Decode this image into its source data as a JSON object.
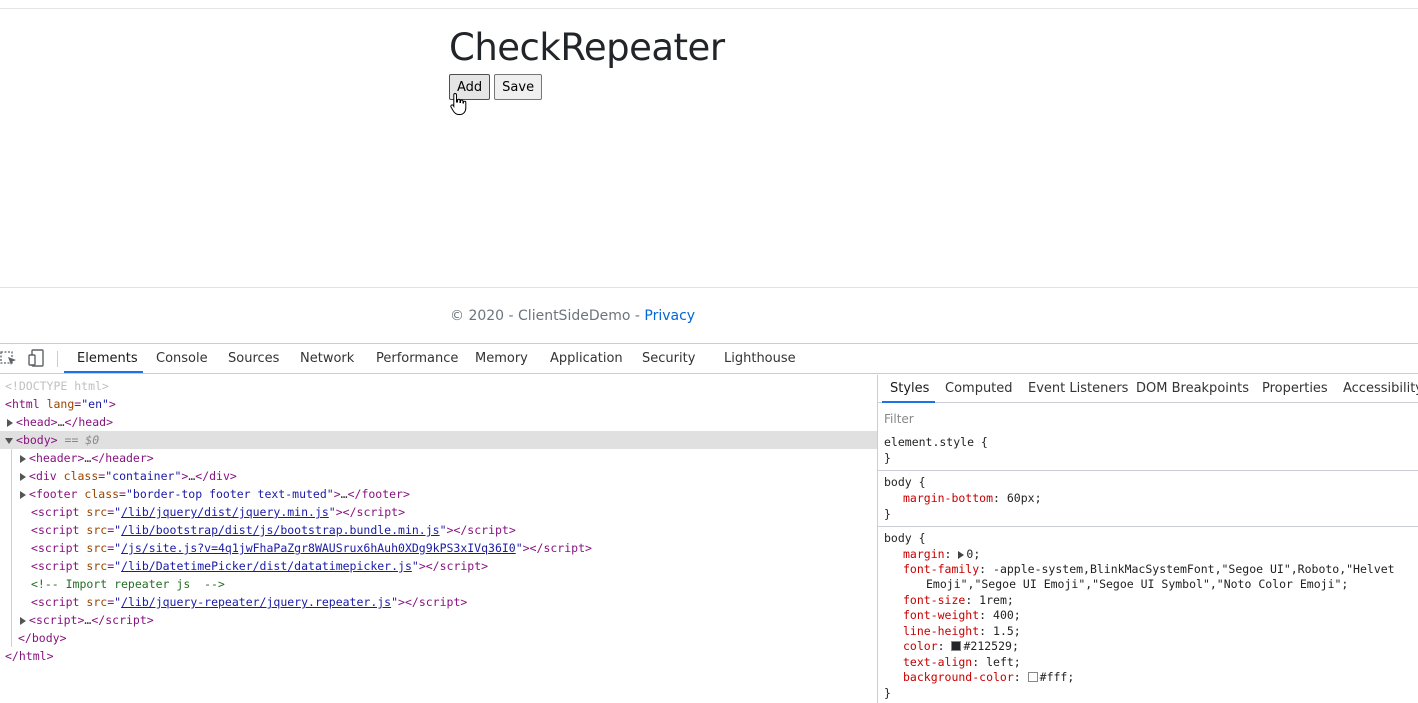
{
  "page": {
    "title": "CheckRepeater",
    "add_label": "Add",
    "save_label": "Save",
    "footer_text": "© 2020 - ClientSideDemo - ",
    "footer_link": "Privacy"
  },
  "devtools": {
    "tabs": [
      "Elements",
      "Console",
      "Sources",
      "Network",
      "Performance",
      "Memory",
      "Application",
      "Security",
      "Lighthouse"
    ],
    "styles_tabs": [
      "Styles",
      "Computed",
      "Event Listeners",
      "DOM Breakpoints",
      "Properties",
      "Accessibility"
    ],
    "filter_placeholder": "Filter",
    "dom": {
      "doctype": "<!DOCTYPE html>",
      "html_open_tag": "html",
      "html_lang_attr": "lang",
      "html_lang_val": "\"en\"",
      "head_tag": "head",
      "body_tag": "body",
      "body_eq": "== $0",
      "header_tag": "header",
      "div_tag": "div",
      "div_class_attr": "class",
      "div_class_val": "\"container\"",
      "footer_tag": "footer",
      "footer_class_attr": "class",
      "footer_class_val": "\"border-top footer text-muted\"",
      "script_tag": "script",
      "src_attr": "src",
      "scripts": [
        "/lib/jquery/dist/jquery.min.js",
        "/lib/bootstrap/dist/js/bootstrap.bundle.min.js",
        "/js/site.js?v=4q1jwFhaPaZgr8WAUSrux6hAuh0XDg9kPS3xIVq36I0",
        "/lib/DatetimePicker/dist/datatimepicker.js"
      ],
      "comment": "<!-- Import repeater js  -->",
      "repeater_script": "/lib/jquery-repeater/jquery.repeater.js",
      "ellipsis": "…"
    },
    "styles": {
      "element_style": "element.style {",
      "close_brace": "}",
      "body_selector": "body {",
      "margin_bottom_prop": "margin-bottom",
      "margin_bottom_val": "60px;",
      "margin_prop": "margin",
      "margin_val": "0;",
      "font_family_prop": "font-family",
      "font_family_val": "-apple-system,BlinkMacSystemFont,\"Segoe UI\",Roboto,\"Helvet",
      "font_family_cont": "Emoji\",\"Segoe UI Emoji\",\"Segoe UI Symbol\",\"Noto Color Emoji\";",
      "font_size_prop": "font-size",
      "font_size_val": "1rem;",
      "font_weight_prop": "font-weight",
      "font_weight_val": "400;",
      "line_height_prop": "line-height",
      "line_height_val": "1.5;",
      "color_prop": "color",
      "color_val": "#212529;",
      "color_swatch": "#212529",
      "text_align_prop": "text-align",
      "text_align_val": "left;",
      "bg_color_prop": "background-color",
      "bg_color_val": "#fff;",
      "bg_swatch": "#ffffff"
    }
  }
}
